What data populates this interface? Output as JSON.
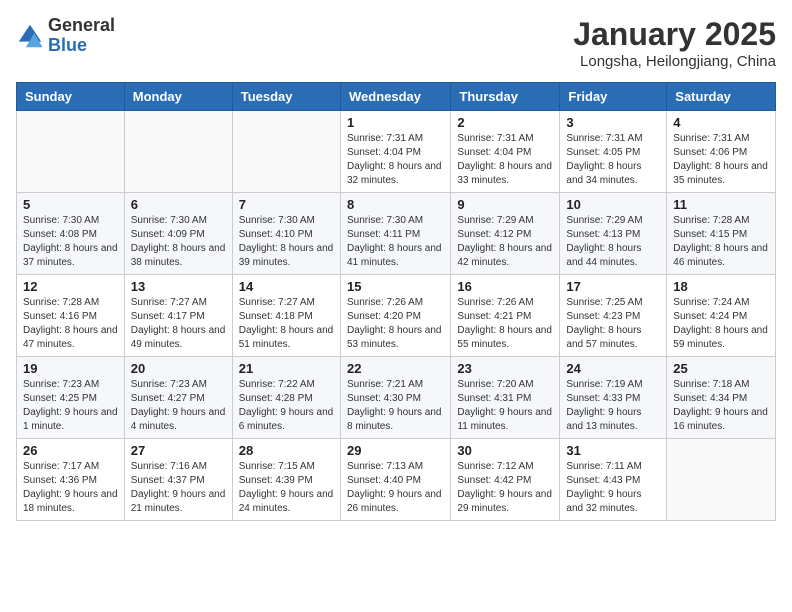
{
  "header": {
    "logo_general": "General",
    "logo_blue": "Blue",
    "month_title": "January 2025",
    "location": "Longsha, Heilongjiang, China"
  },
  "days_of_week": [
    "Sunday",
    "Monday",
    "Tuesday",
    "Wednesday",
    "Thursday",
    "Friday",
    "Saturday"
  ],
  "weeks": [
    [
      {
        "day": "",
        "info": ""
      },
      {
        "day": "",
        "info": ""
      },
      {
        "day": "",
        "info": ""
      },
      {
        "day": "1",
        "info": "Sunrise: 7:31 AM\nSunset: 4:04 PM\nDaylight: 8 hours and 32 minutes."
      },
      {
        "day": "2",
        "info": "Sunrise: 7:31 AM\nSunset: 4:04 PM\nDaylight: 8 hours and 33 minutes."
      },
      {
        "day": "3",
        "info": "Sunrise: 7:31 AM\nSunset: 4:05 PM\nDaylight: 8 hours and 34 minutes."
      },
      {
        "day": "4",
        "info": "Sunrise: 7:31 AM\nSunset: 4:06 PM\nDaylight: 8 hours and 35 minutes."
      }
    ],
    [
      {
        "day": "5",
        "info": "Sunrise: 7:30 AM\nSunset: 4:08 PM\nDaylight: 8 hours and 37 minutes."
      },
      {
        "day": "6",
        "info": "Sunrise: 7:30 AM\nSunset: 4:09 PM\nDaylight: 8 hours and 38 minutes."
      },
      {
        "day": "7",
        "info": "Sunrise: 7:30 AM\nSunset: 4:10 PM\nDaylight: 8 hours and 39 minutes."
      },
      {
        "day": "8",
        "info": "Sunrise: 7:30 AM\nSunset: 4:11 PM\nDaylight: 8 hours and 41 minutes."
      },
      {
        "day": "9",
        "info": "Sunrise: 7:29 AM\nSunset: 4:12 PM\nDaylight: 8 hours and 42 minutes."
      },
      {
        "day": "10",
        "info": "Sunrise: 7:29 AM\nSunset: 4:13 PM\nDaylight: 8 hours and 44 minutes."
      },
      {
        "day": "11",
        "info": "Sunrise: 7:28 AM\nSunset: 4:15 PM\nDaylight: 8 hours and 46 minutes."
      }
    ],
    [
      {
        "day": "12",
        "info": "Sunrise: 7:28 AM\nSunset: 4:16 PM\nDaylight: 8 hours and 47 minutes."
      },
      {
        "day": "13",
        "info": "Sunrise: 7:27 AM\nSunset: 4:17 PM\nDaylight: 8 hours and 49 minutes."
      },
      {
        "day": "14",
        "info": "Sunrise: 7:27 AM\nSunset: 4:18 PM\nDaylight: 8 hours and 51 minutes."
      },
      {
        "day": "15",
        "info": "Sunrise: 7:26 AM\nSunset: 4:20 PM\nDaylight: 8 hours and 53 minutes."
      },
      {
        "day": "16",
        "info": "Sunrise: 7:26 AM\nSunset: 4:21 PM\nDaylight: 8 hours and 55 minutes."
      },
      {
        "day": "17",
        "info": "Sunrise: 7:25 AM\nSunset: 4:23 PM\nDaylight: 8 hours and 57 minutes."
      },
      {
        "day": "18",
        "info": "Sunrise: 7:24 AM\nSunset: 4:24 PM\nDaylight: 8 hours and 59 minutes."
      }
    ],
    [
      {
        "day": "19",
        "info": "Sunrise: 7:23 AM\nSunset: 4:25 PM\nDaylight: 9 hours and 1 minute."
      },
      {
        "day": "20",
        "info": "Sunrise: 7:23 AM\nSunset: 4:27 PM\nDaylight: 9 hours and 4 minutes."
      },
      {
        "day": "21",
        "info": "Sunrise: 7:22 AM\nSunset: 4:28 PM\nDaylight: 9 hours and 6 minutes."
      },
      {
        "day": "22",
        "info": "Sunrise: 7:21 AM\nSunset: 4:30 PM\nDaylight: 9 hours and 8 minutes."
      },
      {
        "day": "23",
        "info": "Sunrise: 7:20 AM\nSunset: 4:31 PM\nDaylight: 9 hours and 11 minutes."
      },
      {
        "day": "24",
        "info": "Sunrise: 7:19 AM\nSunset: 4:33 PM\nDaylight: 9 hours and 13 minutes."
      },
      {
        "day": "25",
        "info": "Sunrise: 7:18 AM\nSunset: 4:34 PM\nDaylight: 9 hours and 16 minutes."
      }
    ],
    [
      {
        "day": "26",
        "info": "Sunrise: 7:17 AM\nSunset: 4:36 PM\nDaylight: 9 hours and 18 minutes."
      },
      {
        "day": "27",
        "info": "Sunrise: 7:16 AM\nSunset: 4:37 PM\nDaylight: 9 hours and 21 minutes."
      },
      {
        "day": "28",
        "info": "Sunrise: 7:15 AM\nSunset: 4:39 PM\nDaylight: 9 hours and 24 minutes."
      },
      {
        "day": "29",
        "info": "Sunrise: 7:13 AM\nSunset: 4:40 PM\nDaylight: 9 hours and 26 minutes."
      },
      {
        "day": "30",
        "info": "Sunrise: 7:12 AM\nSunset: 4:42 PM\nDaylight: 9 hours and 29 minutes."
      },
      {
        "day": "31",
        "info": "Sunrise: 7:11 AM\nSunset: 4:43 PM\nDaylight: 9 hours and 32 minutes."
      },
      {
        "day": "",
        "info": ""
      }
    ]
  ]
}
